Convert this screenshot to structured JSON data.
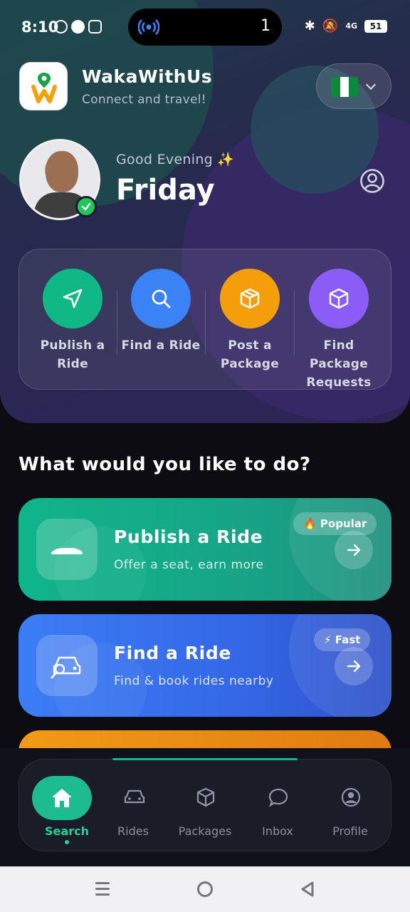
{
  "status_bar": {
    "time": "8:10",
    "pill_count": "1",
    "network": "4G",
    "battery": "51"
  },
  "header": {
    "app_name": "WakaWithUs",
    "tagline": "Connect and travel!"
  },
  "greeting": {
    "text": "Good Evening ✨",
    "name": "Friday"
  },
  "quick_actions": [
    {
      "label": "Publish a Ride",
      "color": "#10b886",
      "icon": "send-icon"
    },
    {
      "label": "Find a Ride",
      "color": "#3b82f6",
      "icon": "search-icon"
    },
    {
      "label": "Post a Package",
      "color": "#f59e0b",
      "icon": "box-icon"
    },
    {
      "label": "Find Package Requests",
      "color": "#8b5cf6",
      "icon": "package-icon"
    }
  ],
  "section": {
    "title": "What would you like to do?"
  },
  "cards": [
    {
      "title": "Publish a Ride",
      "subtitle": "Offer a seat, earn more",
      "badge": "🔥 Popular",
      "icon": "car-icon"
    },
    {
      "title": "Find a Ride",
      "subtitle": "Find & book rides nearby",
      "badge": "⚡ Fast",
      "icon": "car-search-icon"
    }
  ],
  "bottom_nav": [
    {
      "label": "Search",
      "icon": "home-icon",
      "active": true
    },
    {
      "label": "Rides",
      "icon": "car-icon",
      "active": false
    },
    {
      "label": "Packages",
      "icon": "box-icon",
      "active": false
    },
    {
      "label": "Inbox",
      "icon": "chat-icon",
      "active": false
    },
    {
      "label": "Profile",
      "icon": "user-icon",
      "active": false
    }
  ],
  "colors": {
    "accent": "#1dbb8e",
    "publish": "#10b58a",
    "find": "#3c7df5",
    "package": "#f29a17"
  }
}
